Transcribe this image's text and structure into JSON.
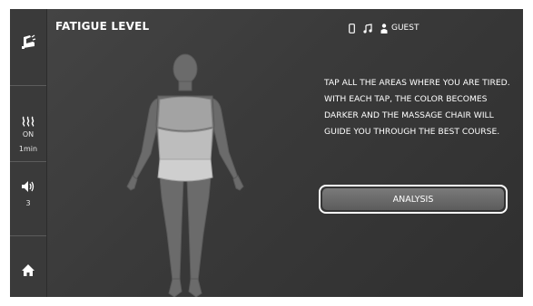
{
  "header": {
    "title": "FATIGUE LEVEL",
    "status_icons": [
      "phone-icon",
      "music-note-icon",
      "person-icon"
    ],
    "user_label": "GUEST"
  },
  "sidebar": {
    "chair_icon": "massage-chair-icon",
    "heat": {
      "icon": "heat-waves-icon",
      "state": "ON",
      "duration": "1min"
    },
    "volume": {
      "icon": "speaker-icon",
      "level": "3"
    },
    "home_icon": "home-icon"
  },
  "main": {
    "instruction": "TAP ALL THE AREAS WHERE YOU ARE TIRED. WITH EACH TAP, THE COLOR BECOMES DARKER AND THE MASSAGE CHAIR WILL GUIDE YOU THROUGH THE BEST COURSE.",
    "analysis_label": "ANALYSIS",
    "body_regions_selected": [
      "upper-back",
      "lower-back"
    ]
  },
  "colors": {
    "background": "#3a3a3a",
    "sidebar": "#3a3a3a",
    "body_fill": "#6b6b6b",
    "selected_region_light": "#c9c9c9",
    "selected_region_mid": "#a8a8a8",
    "text": "#ffffff"
  }
}
